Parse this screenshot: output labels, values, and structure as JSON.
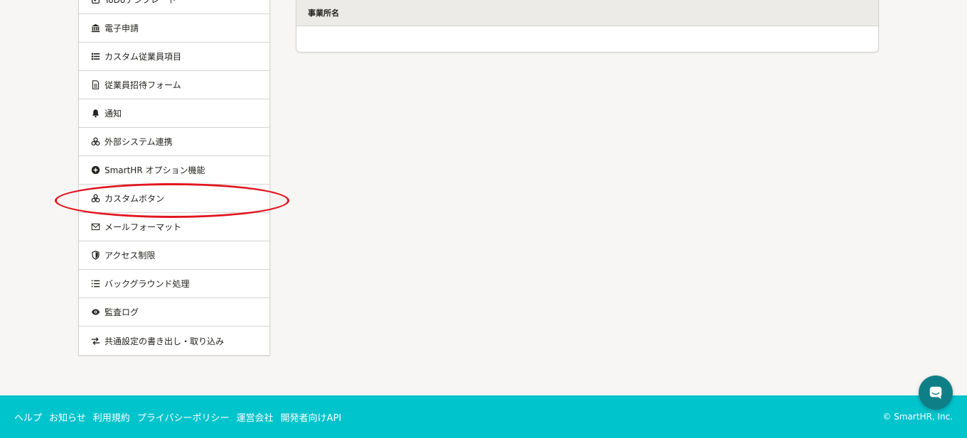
{
  "sidebar": {
    "items": [
      {
        "label": "ToDoテンプレート",
        "icon": "todo-check-icon"
      },
      {
        "label": "電子申請",
        "icon": "bank-icon"
      },
      {
        "label": "カスタム従業員項目",
        "icon": "list-icon"
      },
      {
        "label": "従業員招待フォーム",
        "icon": "document-icon"
      },
      {
        "label": "通知",
        "icon": "bell-icon"
      },
      {
        "label": "外部システム連携",
        "icon": "cubes-icon"
      },
      {
        "label": "SmartHR オプション機能",
        "icon": "plus-circle-icon"
      },
      {
        "label": "カスタムボタン",
        "icon": "cubes-icon"
      },
      {
        "label": "メールフォーマット",
        "icon": "envelope-icon"
      },
      {
        "label": "アクセス制限",
        "icon": "shield-icon"
      },
      {
        "label": "バックグラウンド処理",
        "icon": "ordered-list-icon"
      },
      {
        "label": "監査ログ",
        "icon": "eye-icon"
      },
      {
        "label": "共通設定の書き出し・取り込み",
        "icon": "exchange-icon"
      }
    ]
  },
  "table": {
    "header": "事業所名"
  },
  "footer": {
    "links": [
      "ヘルプ",
      "お知らせ",
      "利用規約",
      "プライバシーポリシー",
      "運営会社",
      "開発者向けAPI"
    ],
    "copyright": "© SmartHR, Inc."
  },
  "colors": {
    "footer_bg": "#00c4cc",
    "highlight": "#e0161f",
    "chat_button": "#0e7f87"
  }
}
